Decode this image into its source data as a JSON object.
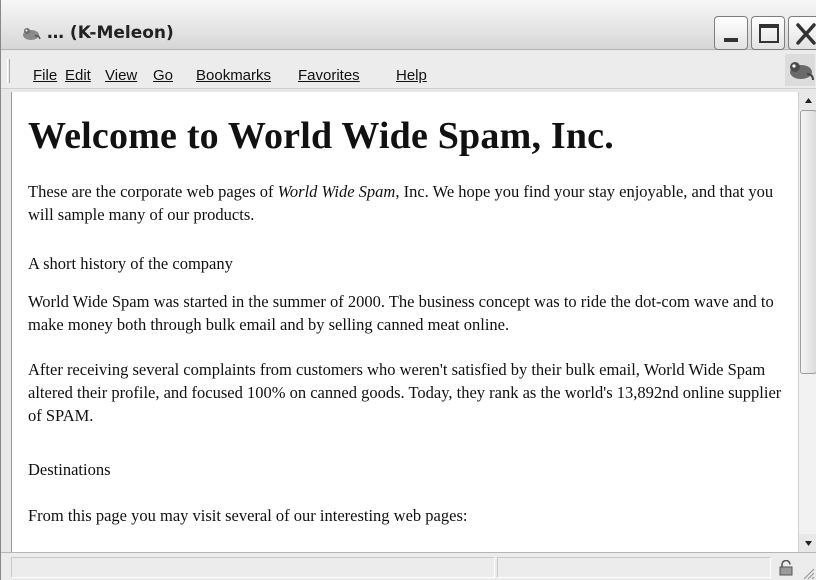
{
  "window": {
    "title": "… (K-Meleon)"
  },
  "menubar": {
    "items": [
      "File",
      "Edit",
      "View",
      "Go",
      "Bookmarks",
      "Favorites",
      "Help"
    ]
  },
  "page": {
    "title": "Welcome to World Wide Spam, Inc.",
    "intro_before": "These are the corporate web pages of ",
    "intro_em": "World Wide Spam",
    "intro_after": ", Inc. We hope you find your stay enjoyable, and that you will sample many of our products.",
    "history_heading": "A short history of the company",
    "history_p1": "World Wide Spam was started in the summer of 2000. The business concept was to ride the dot-com wave and to make money both through bulk email and by selling canned meat online.",
    "history_p2": "After receiving several complaints from customers who weren't satisfied by their bulk email, World Wide Spam altered their profile, and focused 100% on canned goods. Today, they rank as the world's 13,892nd online supplier of SPAM.",
    "destinations_heading": "Destinations",
    "destinations_intro": "From this page you may visit several of our interesting web pages:"
  },
  "icons": {
    "app": "kmeleon-app-icon",
    "minimize": "minimize-icon",
    "maximize": "maximize-icon",
    "close": "close-icon",
    "throbber": "kmeleon-throbber-icon",
    "lock": "lock-icon",
    "scroll_up": "scroll-up-arrow-icon",
    "scroll_down": "scroll-down-arrow-icon",
    "resize": "resize-grip-icon"
  }
}
